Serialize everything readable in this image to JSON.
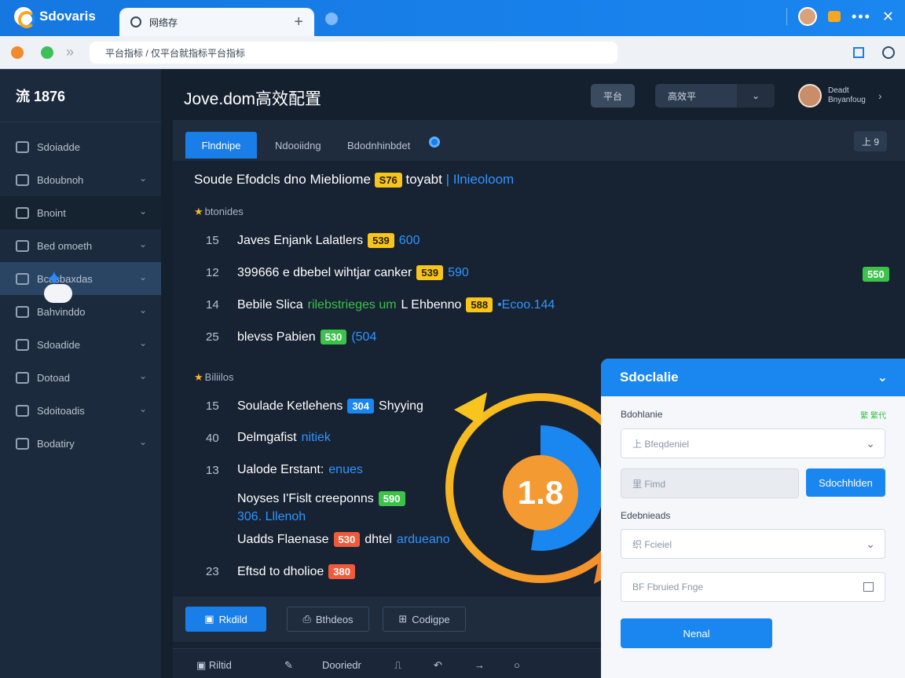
{
  "browser": {
    "brand": "Sdovaris",
    "tab_title": "网络存",
    "url": "平台指标 / 仅平台就指标平台指标"
  },
  "sidebar": {
    "header": "流 1876",
    "items": [
      {
        "label": "Sdoiadde"
      },
      {
        "label": "Bdoubnoh"
      },
      {
        "label": "Bnoint"
      },
      {
        "label": "Bed omoeth"
      },
      {
        "label": "Bcasbaxdas"
      },
      {
        "label": "Bahvinddo"
      },
      {
        "label": "Sdoadide"
      },
      {
        "label": "Dotoad"
      },
      {
        "label": "Sdoitoadis"
      },
      {
        "label": "Bodatiry"
      }
    ]
  },
  "header": {
    "title": "Jove.dom高效配置",
    "btn1": "平台",
    "select": "高效平",
    "user_line1": "Deadt",
    "user_line2": "Bnyanfoug"
  },
  "tabs": {
    "items": [
      "Flndnipe",
      "Ndooiidng",
      "Bdodnhinbdet"
    ],
    "control": "上 9"
  },
  "content": {
    "heading": "Soude Efodcls dno Miebliome",
    "heading_badge": "S76",
    "heading_after": "toyabt",
    "heading_link": "| Ilnieoloom",
    "section1": "btonides",
    "rows1": [
      {
        "num": "15",
        "text": "Javes Enjank Lalatlers",
        "badge": "539",
        "extra": "600"
      },
      {
        "num": "12",
        "text": "399666 e dbebel wihtjar canker",
        "badge": "539",
        "extra": "590"
      },
      {
        "num": "14",
        "text": "Bebile Slica",
        "green_text": "rilebstrieges um",
        "text2": "L Ehbenno",
        "badge": "588",
        "extra": "•Ecoo.144"
      },
      {
        "num": "25",
        "text": "blevss Pabien",
        "badge": "530",
        "extra": "(504"
      }
    ],
    "right_badge": "550",
    "section2": "Biliilos",
    "rows2": [
      {
        "num": "15",
        "text": "Soulade Ketlehens",
        "badge": "304",
        "after": "Shyying"
      },
      {
        "num": "40",
        "text": "Delmgafist",
        "extra": "nitiek"
      },
      {
        "num": "13",
        "text": "Ualode Erstant:",
        "extra": "enues"
      },
      {
        "num": "",
        "text": "Noyses I'Fislt creeponns",
        "badge": "590",
        "line2": "306. Lllenoh"
      },
      {
        "num": "",
        "text": "Uadds Flaenase",
        "badge": "530",
        "after": "dhtel",
        "extra": "ardueano"
      },
      {
        "num": "23",
        "text": "Eftsd to dholioe",
        "badge": "380"
      }
    ]
  },
  "gauge": {
    "value": "1.8"
  },
  "footer": {
    "primary": "Rkdild",
    "ghost1": "Bthdeos",
    "ghost2": "Codigpe",
    "status_left": "Riltid",
    "status_mid": "Dooriedr"
  },
  "modal": {
    "title": "Sdoclalie",
    "label1": "Bdohlanie",
    "hint1": "繁 繁代",
    "select1": "上  Bfeqdeniel",
    "input_gray": "里  Fimd",
    "btn_side": "Sdochhlden",
    "label2": "Edebnieads",
    "select2": "织  Fcieiel",
    "date": "BF  Fbruied Fnge",
    "submit": "Nenal"
  },
  "colors": {
    "accent": "#1a86f0",
    "badge_yellow": "#f7c51e",
    "badge_green": "#3cc24a",
    "badge_red": "#ee5a3a",
    "gauge_orange": "#f39a32"
  }
}
